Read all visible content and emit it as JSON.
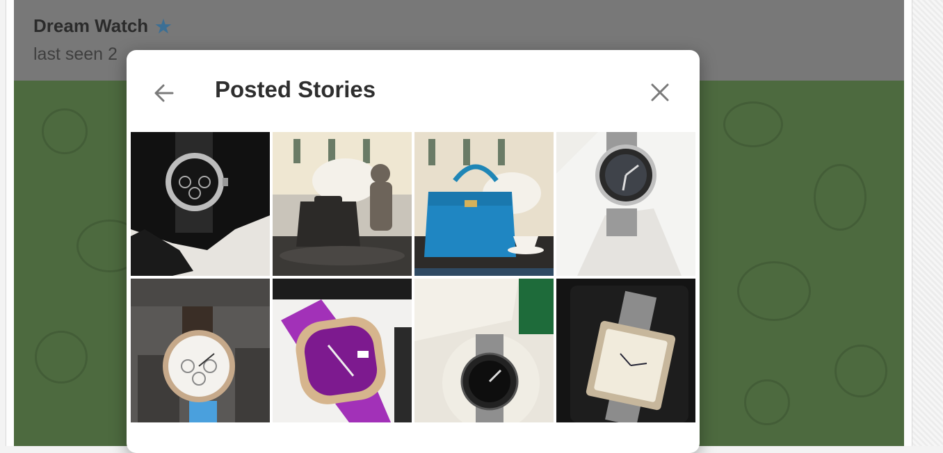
{
  "chat": {
    "title": "Dream Watch",
    "status": "last seen 2",
    "verified_icon": "star-icon"
  },
  "modal": {
    "title": "Posted Stories",
    "back_icon": "arrow-left-icon",
    "close_icon": "close-icon"
  },
  "stories": [
    {
      "subject": "black-dial chronograph watch in black-gloved hand"
    },
    {
      "subject": "dark handbag with bear figurine and white flowers"
    },
    {
      "subject": "blue handbag with teacup and white flowers"
    },
    {
      "subject": "steel dive watch in white-gloved hand"
    },
    {
      "subject": "white-dial chronograph watch on dark strap"
    },
    {
      "subject": "purple-dial watch on purple strap"
    },
    {
      "subject": "black-bezel steel watch in display box"
    },
    {
      "subject": "rectangular roman-numeral watch on steel bracelet"
    }
  ]
}
